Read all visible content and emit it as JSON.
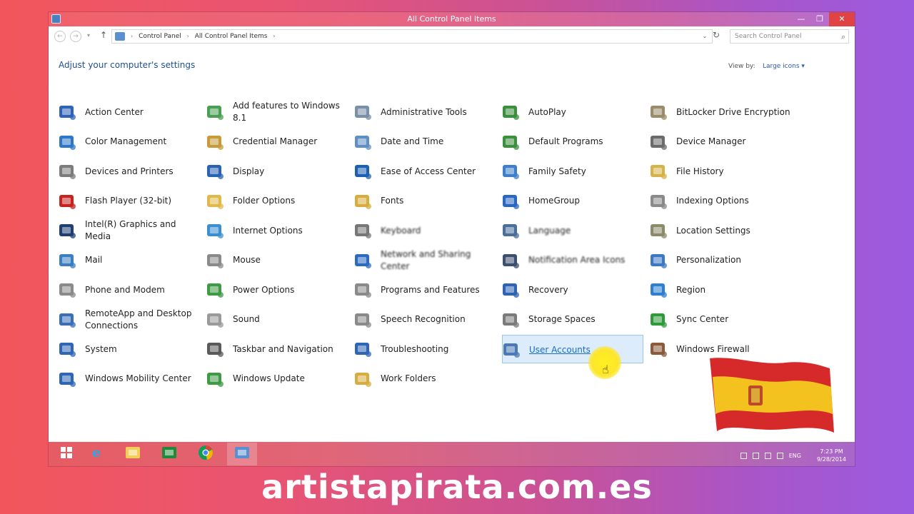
{
  "window": {
    "title": "All Control Panel Items",
    "minimize_glyph": "—",
    "maximize_glyph": "❐",
    "close_glyph": "✕"
  },
  "address_bar": {
    "back_glyph": "←",
    "forward_glyph": "→",
    "history_glyph": "▾",
    "up_glyph": "↑",
    "crumbs": [
      "Control Panel",
      "All Control Panel Items"
    ],
    "separator": "›",
    "dropdown_glyph": "⌄",
    "refresh_glyph": "↻",
    "search_placeholder": "Search Control Panel",
    "search_glyph": "⌕"
  },
  "header": {
    "title": "Adjust your computer's settings",
    "view_by_label": "View by:",
    "view_by_value": "Large icons ▾"
  },
  "items": [
    {
      "label": "Action Center",
      "icon": "flag-icon",
      "color": "#2f63b8"
    },
    {
      "label": "Add features to Windows 8.1",
      "icon": "add-features-icon",
      "color": "#4aa052"
    },
    {
      "label": "Administrative Tools",
      "icon": "admin-tools-icon",
      "color": "#7a8fa8"
    },
    {
      "label": "AutoPlay",
      "icon": "autoplay-icon",
      "color": "#3b8f3e"
    },
    {
      "label": "BitLocker Drive Encryption",
      "icon": "key-icon",
      "color": "#9a8c6a"
    },
    {
      "label": "Color Management",
      "icon": "color-management-icon",
      "color": "#2e77c8"
    },
    {
      "label": "Credential Manager",
      "icon": "credential-icon",
      "color": "#c89a3a"
    },
    {
      "label": "Date and Time",
      "icon": "clock-icon",
      "color": "#5f8fc4"
    },
    {
      "label": "Default Programs",
      "icon": "default-programs-icon",
      "color": "#3b8f3e"
    },
    {
      "label": "Device Manager",
      "icon": "device-manager-icon",
      "color": "#6b6b6b"
    },
    {
      "label": "Devices and Printers",
      "icon": "printer-icon",
      "color": "#7c7c7c"
    },
    {
      "label": "Display",
      "icon": "display-icon",
      "color": "#2b63b3"
    },
    {
      "label": "Ease of Access Center",
      "icon": "ease-of-access-icon",
      "color": "#1d5fb1"
    },
    {
      "label": "Family Safety",
      "icon": "family-safety-icon",
      "color": "#3f7fc9"
    },
    {
      "label": "File History",
      "icon": "file-history-icon",
      "color": "#d6b24a"
    },
    {
      "label": "Flash Player (32-bit)",
      "icon": "flash-icon",
      "color": "#c6231f"
    },
    {
      "label": "Folder Options",
      "icon": "folder-icon",
      "color": "#e1b94a"
    },
    {
      "label": "Fonts",
      "icon": "fonts-icon",
      "color": "#d6ad3e"
    },
    {
      "label": "HomeGroup",
      "icon": "homegroup-icon",
      "color": "#2a67bf"
    },
    {
      "label": "Indexing Options",
      "icon": "indexing-icon",
      "color": "#8a8a8a"
    },
    {
      "label": "Intel(R) Graphics and Media",
      "icon": "intel-graphics-icon",
      "color": "#1f3f72"
    },
    {
      "label": "Internet Options",
      "icon": "internet-options-icon",
      "color": "#3b8fd0"
    },
    {
      "label": "Keyboard",
      "icon": "keyboard-icon",
      "color": "#777777"
    },
    {
      "label": "Language",
      "icon": "language-icon",
      "color": "#4c6f99"
    },
    {
      "label": "Location Settings",
      "icon": "location-icon",
      "color": "#8b8b6a"
    },
    {
      "label": "Mail",
      "icon": "mail-icon",
      "color": "#3a7ec4"
    },
    {
      "label": "Mouse",
      "icon": "mouse-icon",
      "color": "#8a8a8a"
    },
    {
      "label": "Network and Sharing Center",
      "icon": "network-icon",
      "color": "#2d6bc2"
    },
    {
      "label": "Notification Area Icons",
      "icon": "notification-icon",
      "color": "#3c4f6e"
    },
    {
      "label": "Personalization",
      "icon": "personalization-icon",
      "color": "#3d79c3"
    },
    {
      "label": "Phone and Modem",
      "icon": "phone-modem-icon",
      "color": "#8a8a8a"
    },
    {
      "label": "Power Options",
      "icon": "power-icon",
      "color": "#3e9a45"
    },
    {
      "label": "Programs and Features",
      "icon": "programs-icon",
      "color": "#8a8a8a"
    },
    {
      "label": "Recovery",
      "icon": "recovery-icon",
      "color": "#2d63b2"
    },
    {
      "label": "Region",
      "icon": "globe-icon",
      "color": "#2f7fd0"
    },
    {
      "label": "RemoteApp and Desktop Connections",
      "icon": "remoteapp-icon",
      "color": "#3a6fb8"
    },
    {
      "label": "Sound",
      "icon": "speaker-icon",
      "color": "#9a9a9a"
    },
    {
      "label": "Speech Recognition",
      "icon": "microphone-icon",
      "color": "#8a8a8a"
    },
    {
      "label": "Storage Spaces",
      "icon": "storage-icon",
      "color": "#7b7b7b"
    },
    {
      "label": "Sync Center",
      "icon": "sync-icon",
      "color": "#2f9a3a"
    },
    {
      "label": "System",
      "icon": "system-icon",
      "color": "#2f65b5"
    },
    {
      "label": "Taskbar and Navigation",
      "icon": "taskbar-icon",
      "color": "#5a5a5a"
    },
    {
      "label": "Troubleshooting",
      "icon": "troubleshooting-icon",
      "color": "#2f65b5"
    },
    {
      "label": "User Accounts",
      "icon": "user-accounts-icon",
      "color": "#4b79b5",
      "selected": true
    },
    {
      "label": "Windows Firewall",
      "icon": "firewall-icon",
      "color": "#8a5a3a"
    },
    {
      "label": "Windows Mobility Center",
      "icon": "mobility-icon",
      "color": "#2f65b5"
    },
    {
      "label": "Windows Update",
      "icon": "windows-update-icon",
      "color": "#3e9a45"
    },
    {
      "label": "Work Folders",
      "icon": "work-folders-icon",
      "color": "#d6ad3e"
    }
  ],
  "taskbar": {
    "buttons": [
      {
        "name": "start",
        "icon": "windows-logo-icon",
        "color": "#ffffff"
      },
      {
        "name": "internet-explorer",
        "icon": "internet-explorer-icon",
        "color": "#2aa7e8"
      },
      {
        "name": "file-explorer",
        "icon": "file-explorer-icon",
        "color": "#f3cf58"
      },
      {
        "name": "store",
        "icon": "store-icon",
        "color": "#1f8a3a"
      },
      {
        "name": "chrome",
        "icon": "chrome-icon",
        "color": "#db4437"
      },
      {
        "name": "control-panel",
        "icon": "control-panel-icon",
        "color": "#5a8fd0",
        "active": true
      }
    ],
    "tray_language": "ENG",
    "time": "7:23 PM",
    "date": "9/28/2014"
  },
  "overlay": {
    "watermark": "artistapirata.com.es",
    "flag_colors": {
      "red": "#d62a2a",
      "yellow": "#f4c21f"
    }
  }
}
